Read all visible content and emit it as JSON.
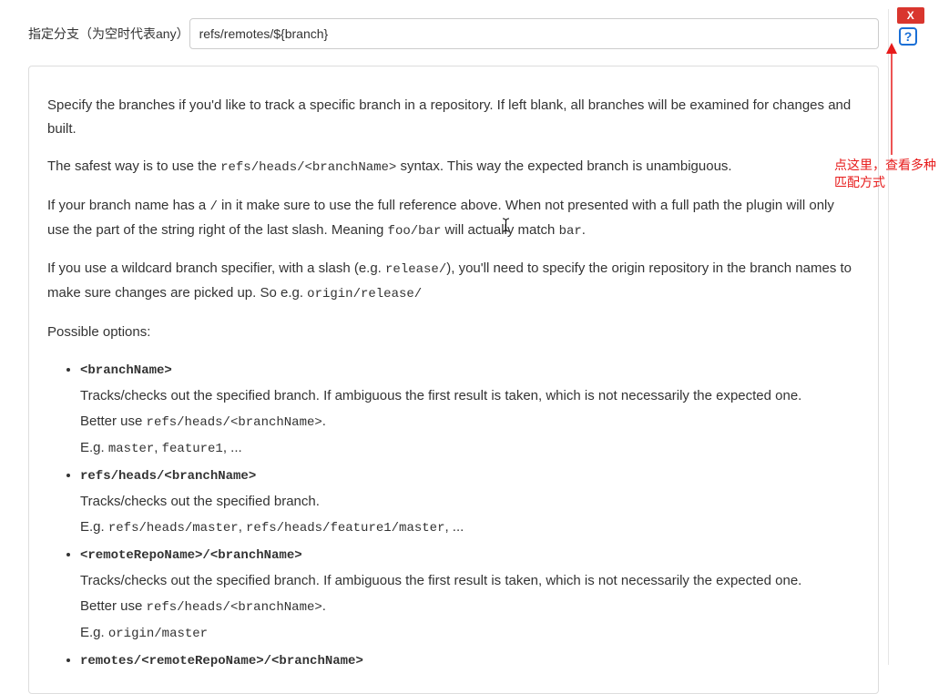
{
  "closeLabel": "X",
  "fieldLabel": "指定分支（为空时代表any）",
  "fieldValue": "refs/remotes/${branch}",
  "helpGlyph": "?",
  "help": {
    "p1a": "Specify the branches if you'd like to track a specific branch in a repository. If left blank, all branches will be examined for changes and built.",
    "p2a": "The safest way is to use the ",
    "p2code": "refs/heads/<branchName>",
    "p2b": " syntax. This way the expected branch is unambiguous.",
    "p3a": "If your branch name has a ",
    "p3slash": "/",
    "p3b": " in it make sure to use the full reference above. When not presented with a full path the plugin will only use the part of the string right of the last slash. Meaning ",
    "p3foo": "foo/bar",
    "p3c": " will actually match ",
    "p3bar": "bar",
    "p3d": ".",
    "p4a": "If you use a wildcard branch specifier, with a slash (e.g. ",
    "p4rel": "release/",
    "p4b": "), you'll need to specify the origin repository in the branch names to make sure changes are picked up. So e.g. ",
    "p4or": "origin/release/",
    "p5": "Possible options:",
    "opts": [
      {
        "head": "<branchName>",
        "l1a": "Tracks/checks out the specified branch. If ambiguous the first result is taken, which is not necessarily the expected one.",
        "l2a": "Better use ",
        "l2code": "refs/heads/<branchName>",
        "l2b": ".",
        "l3a": "E.g. ",
        "l3code": "master",
        "l3b": ", ",
        "l3code2": "feature1",
        "l3c": ", ..."
      },
      {
        "head": "refs/heads/<branchName>",
        "l1a": "Tracks/checks out the specified branch.",
        "l3a": "E.g. ",
        "l3code": "refs/heads/master",
        "l3b": ", ",
        "l3code2": "refs/heads/feature1/master",
        "l3c": ", ..."
      },
      {
        "head": "<remoteRepoName>/<branchName>",
        "l1a": "Tracks/checks out the specified branch. If ambiguous the first result is taken, which is not necessarily the expected one.",
        "l2a": "Better use ",
        "l2code": "refs/heads/<branchName>",
        "l2b": ".",
        "l3a": "E.g. ",
        "l3code": "origin/master",
        "l3b": "",
        "l3code2": "",
        "l3c": ""
      },
      {
        "head": "remotes/<remoteRepoName>/<branchName>"
      }
    ]
  },
  "annotation": "点这里，查看多种匹配方式"
}
